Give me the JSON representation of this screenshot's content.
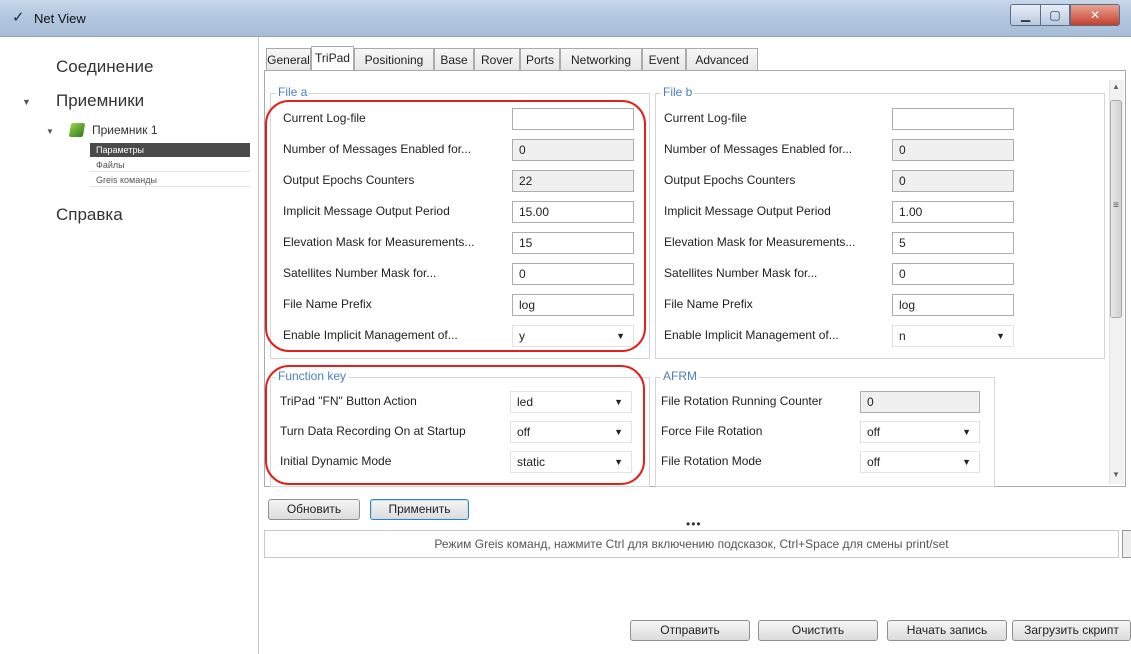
{
  "window": {
    "title": "Net View",
    "logo_glyph": "✓",
    "logo_icon": "app-logo-icon",
    "min_glyph": "▁",
    "max_glyph": "▢",
    "close_glyph": "✕"
  },
  "sidebar": {
    "connection": "Соединение",
    "receivers": "Приемники",
    "receiver1": "Приемник 1",
    "params": "Параметры",
    "files": "Файлы",
    "greis": "Greis команды",
    "help": "Справка",
    "expand_glyph": "▼"
  },
  "tabs": [
    "General",
    "TriPad",
    "Positioning",
    "Base",
    "Rover",
    "Ports",
    "Networking",
    "Event",
    "Advanced"
  ],
  "active_tab": "TriPad",
  "file_a": {
    "title": "File a",
    "fields": [
      {
        "label": "Current Log-file",
        "value": ""
      },
      {
        "label": "Number of Messages Enabled for...",
        "value": "0"
      },
      {
        "label": "Output Epochs Counters",
        "value": "22"
      },
      {
        "label": "Implicit Message Output Period",
        "value": "15.00"
      },
      {
        "label": "Elevation Mask for Measurements...",
        "value": "15"
      },
      {
        "label": "Satellites Number Mask for...",
        "value": "0"
      },
      {
        "label": "File Name Prefix",
        "value": "log"
      },
      {
        "label": "Enable Implicit Management of...",
        "value": "y"
      }
    ]
  },
  "file_b": {
    "title": "File b",
    "fields": [
      {
        "label": "Current Log-file",
        "value": ""
      },
      {
        "label": "Number of Messages Enabled for...",
        "value": "0"
      },
      {
        "label": "Output Epochs Counters",
        "value": "0"
      },
      {
        "label": "Implicit Message Output Period",
        "value": "1.00"
      },
      {
        "label": "Elevation Mask for Measurements...",
        "value": "5"
      },
      {
        "label": "Satellites Number Mask for...",
        "value": "0"
      },
      {
        "label": "File Name Prefix",
        "value": "log"
      },
      {
        "label": "Enable Implicit Management of...",
        "value": "n"
      }
    ]
  },
  "function_key": {
    "title": "Function key",
    "fields": [
      {
        "label": "TriPad \"FN\" Button Action",
        "value": "led"
      },
      {
        "label": "Turn Data Recording On at Startup",
        "value": "off"
      },
      {
        "label": "Initial Dynamic Mode",
        "value": "static"
      }
    ]
  },
  "afrm": {
    "title": "AFRM",
    "fields": [
      {
        "label": "File Rotation Running Counter",
        "value": "0"
      },
      {
        "label": "Force File Rotation",
        "value": "off"
      },
      {
        "label": "File Rotation Mode",
        "value": "off"
      }
    ]
  },
  "dropdown_glyph": "▼",
  "scroll": {
    "up": "▲",
    "down": "▼",
    "grip": "≡"
  },
  "buttons": {
    "refresh": "Обновить",
    "apply": "Применить"
  },
  "grip_dots": "•••",
  "hint": "Режим Greis команд, нажмите  Ctrl для включению подсказок, Ctrl+Space для смены print/set",
  "bottom_buttons": {
    "send": "Отправить",
    "clear": "Очистить",
    "record": "Начать запись",
    "load": "Загрузить скрипт"
  }
}
